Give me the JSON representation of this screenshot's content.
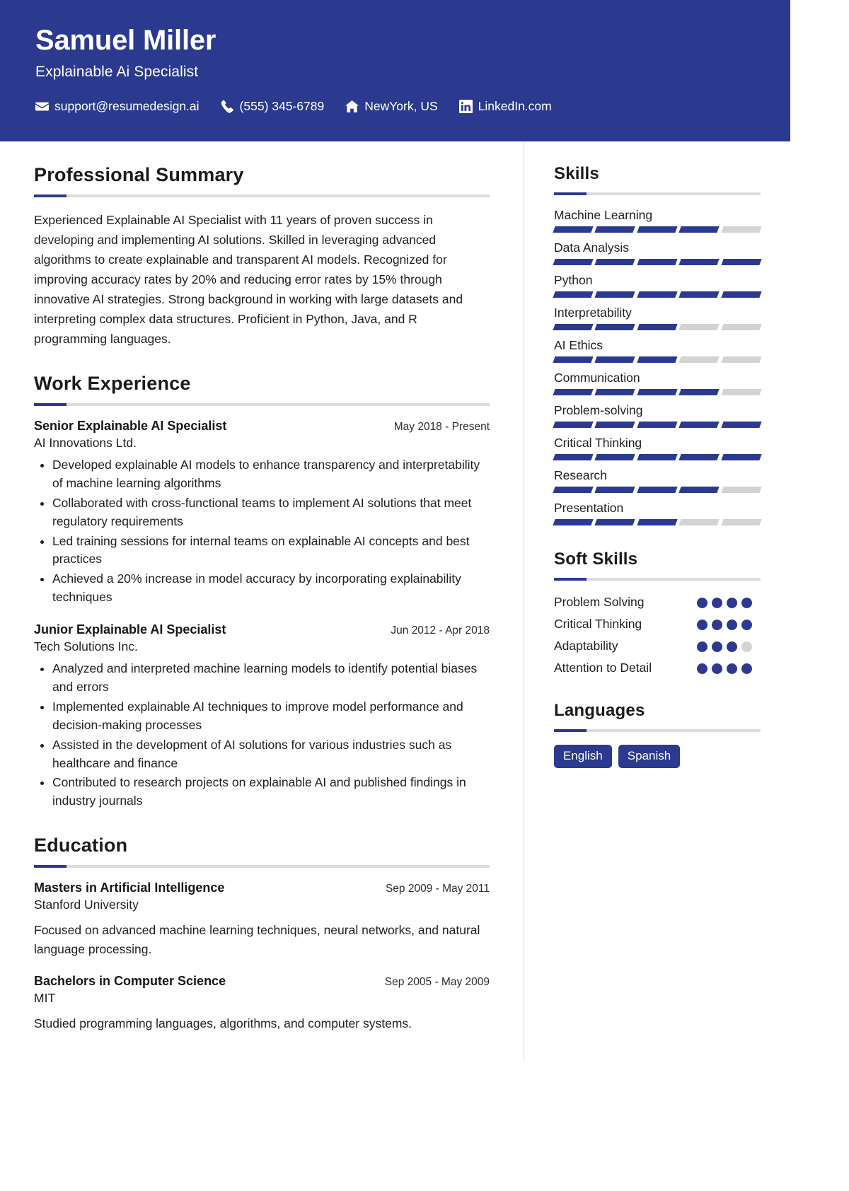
{
  "header": {
    "name": "Samuel Miller",
    "job_title": "Explainable Ai Specialist",
    "bg_color": "#2b3a8f",
    "contacts": [
      {
        "icon": "envelope-icon",
        "text": "support@resumedesign.ai"
      },
      {
        "icon": "phone-icon",
        "text": "(555) 345-6789"
      },
      {
        "icon": "home-icon",
        "text": "NewYork, US"
      },
      {
        "icon": "linkedin-icon",
        "text": "LinkedIn.com"
      }
    ]
  },
  "accent_color": "#2b3a8f",
  "track_color": "#d3d3d3",
  "main": {
    "summary": {
      "heading": "Professional Summary",
      "text": "Experienced Explainable AI Specialist with 11 years of proven success in developing and implementing AI solutions. Skilled in leveraging advanced algorithms to create explainable and transparent AI models. Recognized for improving accuracy rates by 20% and reducing error rates by 15% through innovative AI strategies. Strong background in working with large datasets and interpreting complex data structures. Proficient in Python, Java, and R programming languages."
    },
    "experience": {
      "heading": "Work Experience",
      "items": [
        {
          "title": "Senior Explainable AI Specialist",
          "date": "May 2018 - Present",
          "company": "AI Innovations Ltd.",
          "bullets": [
            "Developed explainable AI models to enhance transparency and interpretability of machine learning algorithms",
            "Collaborated with cross-functional teams to implement AI solutions that meet regulatory requirements",
            "Led training sessions for internal teams on explainable AI concepts and best practices",
            "Achieved a 20% increase in model accuracy by incorporating explainability techniques"
          ]
        },
        {
          "title": "Junior Explainable AI Specialist",
          "date": "Jun 2012 - Apr 2018",
          "company": "Tech Solutions Inc.",
          "bullets": [
            "Analyzed and interpreted machine learning models to identify potential biases and errors",
            "Implemented explainable AI techniques to improve model performance and decision-making processes",
            "Assisted in the development of AI solutions for various industries such as healthcare and finance",
            "Contributed to research projects on explainable AI and published findings in industry journals"
          ]
        }
      ]
    },
    "education": {
      "heading": "Education",
      "items": [
        {
          "title": "Masters in Artificial Intelligence",
          "date": "Sep 2009 - May 2011",
          "school": "Stanford University",
          "description": "Focused on advanced machine learning techniques, neural networks, and natural language processing."
        },
        {
          "title": "Bachelors in Computer Science",
          "date": "Sep 2005 - May 2009",
          "school": "MIT",
          "description": "Studied programming languages, algorithms, and computer systems."
        }
      ]
    }
  },
  "sidebar": {
    "skills": {
      "heading": "Skills",
      "segments_total": 5,
      "items": [
        {
          "name": "Machine Learning",
          "filled": 4
        },
        {
          "name": "Data Analysis",
          "filled": 5
        },
        {
          "name": "Python",
          "filled": 5
        },
        {
          "name": "Interpretability",
          "filled": 3
        },
        {
          "name": "AI Ethics",
          "filled": 3
        },
        {
          "name": "Communication",
          "filled": 4
        },
        {
          "name": "Problem-solving",
          "filled": 5
        },
        {
          "name": "Critical Thinking",
          "filled": 5
        },
        {
          "name": "Research",
          "filled": 4
        },
        {
          "name": "Presentation",
          "filled": 3
        }
      ]
    },
    "soft_skills": {
      "heading": "Soft Skills",
      "dots_total": 4,
      "items": [
        {
          "name": "Problem Solving",
          "filled": 4
        },
        {
          "name": "Critical Thinking",
          "filled": 4
        },
        {
          "name": "Adaptability",
          "filled": 3
        },
        {
          "name": "Attention to Detail",
          "filled": 4
        }
      ]
    },
    "languages": {
      "heading": "Languages",
      "items": [
        "English",
        "Spanish"
      ]
    }
  }
}
